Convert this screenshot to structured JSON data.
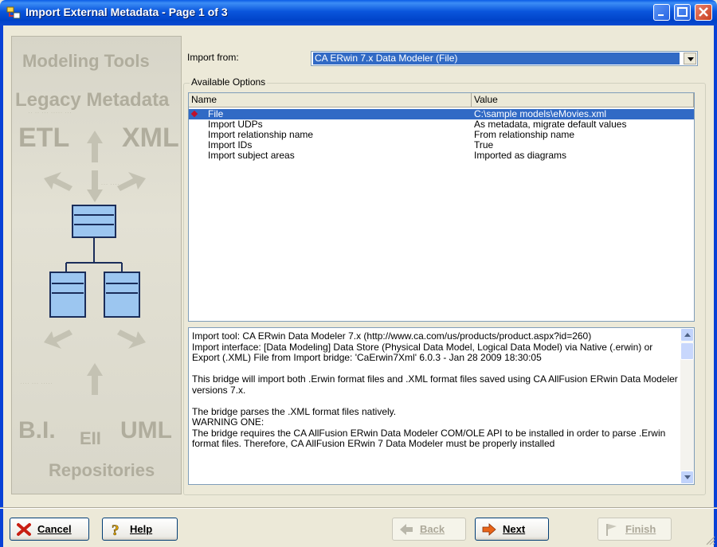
{
  "window": {
    "title": "Import External Metadata - Page 1 of 3",
    "buttons": [
      "minimize",
      "maximize",
      "close"
    ]
  },
  "side_panel": {
    "labels": [
      "Modeling Tools",
      "Legacy Metadata",
      "ETL",
      "XML",
      "B.I.",
      "EII",
      "UML",
      "Repositories"
    ]
  },
  "import_from": {
    "label": "Import from:",
    "value": "CA ERwin 7.x Data Modeler (File)"
  },
  "options": {
    "group_title": "Available Options",
    "columns": [
      "Name",
      "Value"
    ],
    "rows": [
      {
        "name": "File",
        "value": "C:\\sample models\\eMovies.xml",
        "selected": true
      },
      {
        "name": "Import UDPs",
        "value": "As metadata, migrate default values",
        "selected": false
      },
      {
        "name": "Import relationship name",
        "value": "From relationship name",
        "selected": false
      },
      {
        "name": "Import IDs",
        "value": "True",
        "selected": false
      },
      {
        "name": "Import subject areas",
        "value": "Imported as diagrams",
        "selected": false
      }
    ]
  },
  "description": {
    "text": "Import tool: CA ERwin Data Modeler 7.x (http://www.ca.com/us/products/product.aspx?id=260)\nImport interface: [Data Modeling] Data Store (Physical Data Model, Logical Data Model) via Native (.erwin) or Export (.XML) File from  Import bridge: 'CaErwin7Xml' 6.0.3 - Jan 28 2009 18:30:05\n\nThis bridge will import both .Erwin format files and .XML format files saved using CA AllFusion ERwin Data Modeler versions 7.x.\n\nThe bridge parses the .XML format files natively.\nWARNING ONE:\nThe bridge requires the CA AllFusion ERwin Data Modeler COM/OLE API to be installed in order to parse .Erwin format files.  Therefore, CA AllFusion ERwin 7 Data Modeler must be properly installed"
  },
  "footer": {
    "cancel": "Cancel",
    "help": "Help",
    "back": "Back",
    "next": "Next",
    "finish": "Finish"
  },
  "colors": {
    "titlebar": "#0a55dc",
    "selection": "#316ac5",
    "dialog_bg": "#ece9d8"
  }
}
